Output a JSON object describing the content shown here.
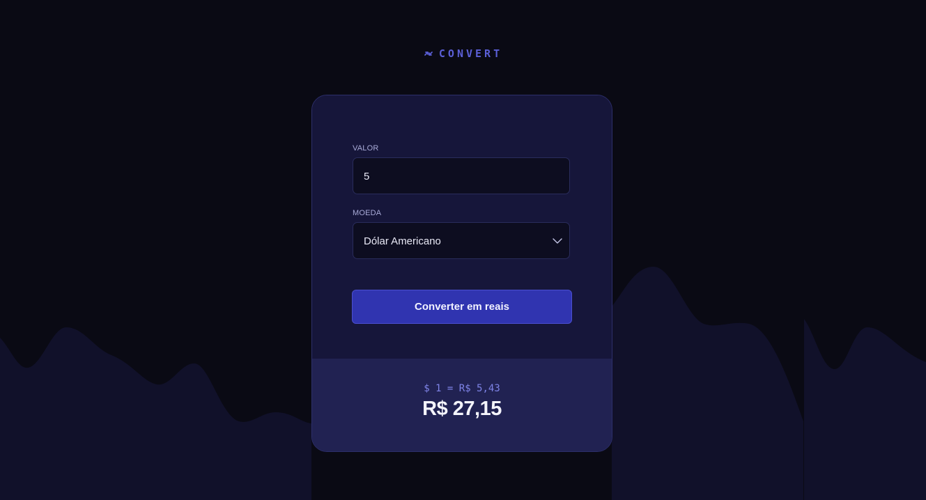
{
  "logo": {
    "text": "CONVERT",
    "icon": "swap-arrows-icon",
    "color": "#5b5fd6"
  },
  "form": {
    "amount_label": "VALOR",
    "amount_value": "5",
    "currency_label": "MOEDA",
    "currency_selected": "Dólar Americano",
    "submit_label": "Converter em reais"
  },
  "result": {
    "rate": "$ 1 = R$ 5,43",
    "total": "R$ 27,15"
  },
  "colors": {
    "background": "#0a0a14",
    "card": "#16163a",
    "result_panel": "#212252",
    "accent": "#3034b0"
  }
}
